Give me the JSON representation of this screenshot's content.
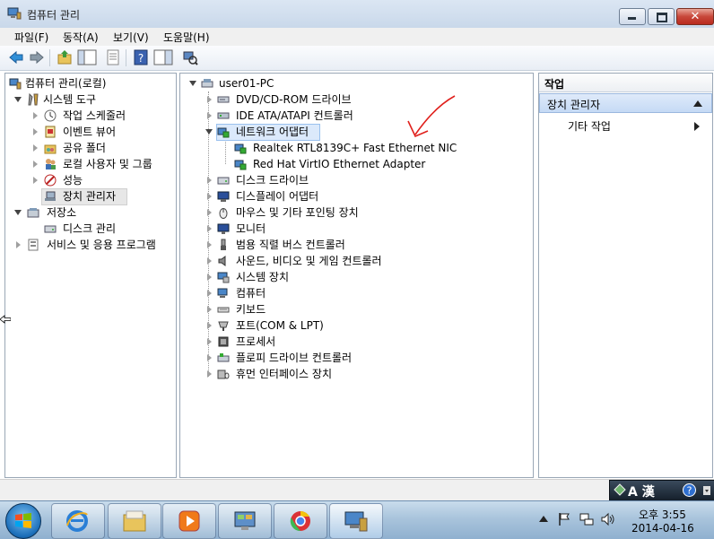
{
  "window": {
    "title": "컴퓨터 관리",
    "close_glyph": "✕"
  },
  "menu": [
    "파일(F)",
    "동작(A)",
    "보기(V)",
    "도움말(H)"
  ],
  "toolbar": {
    "icons": [
      "back-arrow-icon",
      "forward-arrow-icon",
      "up-folder-icon",
      "show-hide-tree-icon",
      "properties-icon",
      "help-icon",
      "show-hide-action-icon",
      "scan-hardware-icon"
    ]
  },
  "left_tree": [
    {
      "label": "컴퓨터 관리(로컬)"
    },
    {
      "label": "시스템 도구"
    },
    {
      "label": "작업 스케줄러"
    },
    {
      "label": "이벤트 뷰어"
    },
    {
      "label": "공유 폴더"
    },
    {
      "label": "로컬 사용자 및 그룹"
    },
    {
      "label": "성능"
    },
    {
      "label": "장치 관리자"
    },
    {
      "label": "저장소"
    },
    {
      "label": "디스크 관리"
    },
    {
      "label": "서비스 및 응용 프로그램"
    }
  ],
  "device_tree": {
    "root": "user01-PC",
    "categories": [
      "DVD/CD-ROM 드라이브",
      "IDE ATA/ATAPI 컨트롤러",
      "네트워크 어댑터",
      "디스크 드라이브",
      "디스플레이 어댑터",
      "마우스 및 기타 포인팅 장치",
      "모니터",
      "범용 직렬 버스 컨트롤러",
      "사운드, 비디오 및 게임 컨트롤러",
      "시스템 장치",
      "컴퓨터",
      "키보드",
      "포트(COM & LPT)",
      "프로세서",
      "플로피 드라이브 컨트롤러",
      "휴먼 인터페이스 장치"
    ],
    "network_children": [
      "Realtek RTL8139C+ Fast Ethernet NIC",
      "Red Hat VirtIO Ethernet Adapter"
    ]
  },
  "actions": {
    "header": "작업",
    "section": "장치 관리자",
    "item": "기타 작업"
  },
  "ime": {
    "label": "A 漢"
  },
  "clock": {
    "time": "오후 3:55",
    "date": "2014-04-16"
  },
  "colors": {
    "annotation": "#e0201c",
    "selection": "#dbe9fb"
  }
}
